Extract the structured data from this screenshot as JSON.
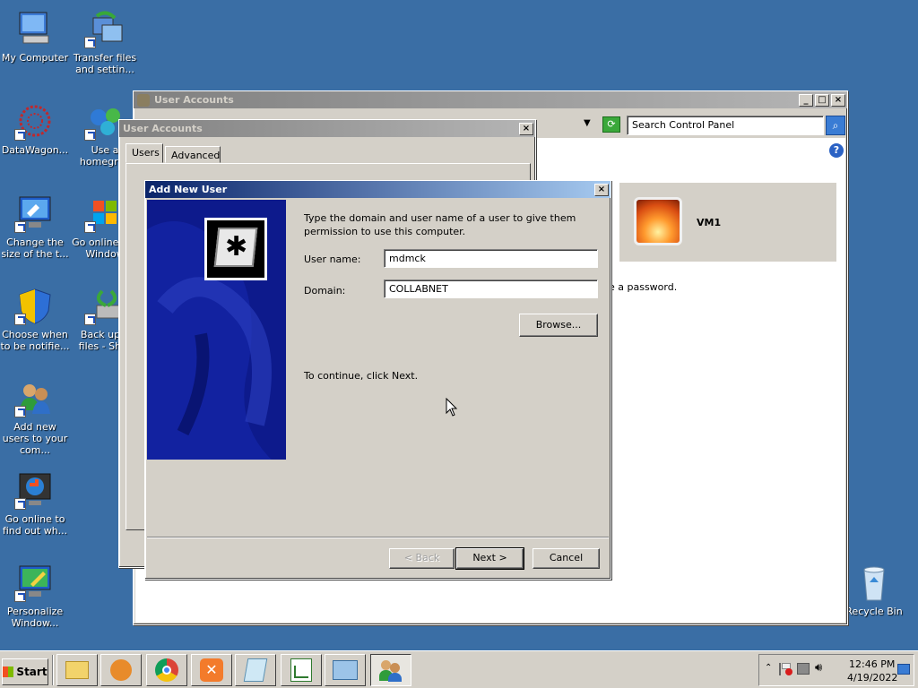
{
  "desktop": {
    "icons": [
      {
        "label": "My Computer"
      },
      {
        "label": "Transfer files and settin..."
      },
      {
        "label": "DataWagon..."
      },
      {
        "label": "Use a homegrou"
      },
      {
        "label": "Change the size of the t..."
      },
      {
        "label": "Go online get Window"
      },
      {
        "label": "Choose when to be notifie..."
      },
      {
        "label": "Back up y files - Shor"
      },
      {
        "label": "Add new users to your com..."
      },
      {
        "label": "Go online to find out wh..."
      },
      {
        "label": "Personalize Window..."
      },
      {
        "label": "Recycle Bin"
      }
    ]
  },
  "control_panel": {
    "title": "User Accounts",
    "search_placeholder": "Search Control Panel",
    "user_name": "VM1",
    "password_text": "e a password."
  },
  "user_accounts_dialog": {
    "title": "User Accounts",
    "tabs": [
      "Users",
      "Advanced"
    ]
  },
  "add_user": {
    "title": "Add New User",
    "instruction": "Type the domain and user name of a user to give them permission to use this computer.",
    "username_label": "User name:",
    "username_value": "mdmck",
    "domain_label": "Domain:",
    "domain_value": "COLLABNET",
    "browse_label": "Browse...",
    "continue_text": "To continue, click Next.",
    "back_label": "< Back",
    "next_label": "Next >",
    "cancel_label": "Cancel"
  },
  "taskbar": {
    "start_label": "Start",
    "time": "12:46 PM",
    "date": "4/19/2022"
  },
  "colors": {
    "desktop": "#3a6ea5",
    "title_active": "#0a246a",
    "wizard_art": "#0d1a8c"
  }
}
